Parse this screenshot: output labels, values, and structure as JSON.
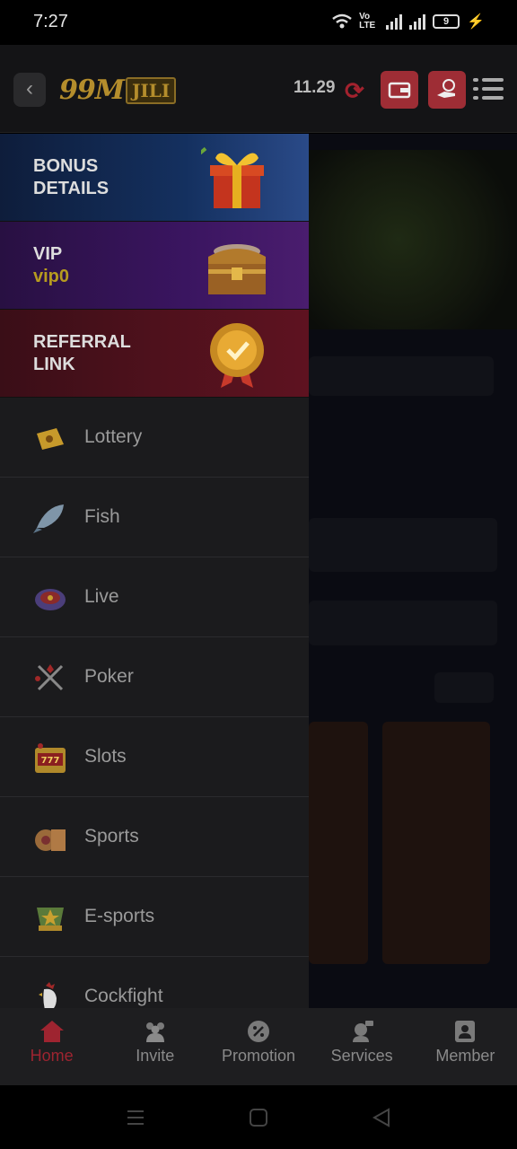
{
  "status_bar": {
    "time": "7:27",
    "network_label": "Vo LTE",
    "battery": "9"
  },
  "header": {
    "logo_main": "99M",
    "logo_badge": "JILI",
    "balance": "11.29"
  },
  "drawer": {
    "promos": [
      {
        "line1": "BONUS",
        "line2": "DETAILS"
      },
      {
        "line1": "VIP",
        "line2": "vip0"
      },
      {
        "line1": "REFERRAL",
        "line2": "LINK"
      }
    ],
    "menu": [
      {
        "label": "Lottery",
        "icon": "lottery-ticket-icon"
      },
      {
        "label": "Fish",
        "icon": "fish-icon"
      },
      {
        "label": "Live",
        "icon": "roulette-icon"
      },
      {
        "label": "Poker",
        "icon": "poker-icon"
      },
      {
        "label": "Slots",
        "icon": "slot-machine-icon"
      },
      {
        "label": "Sports",
        "icon": "sports-icon"
      },
      {
        "label": "E-sports",
        "icon": "esports-icon"
      },
      {
        "label": "Cockfight",
        "icon": "rooster-icon"
      }
    ]
  },
  "bottom_nav": {
    "items": [
      {
        "label": "Home",
        "icon": "home-icon",
        "active": true
      },
      {
        "label": "Invite",
        "icon": "invite-icon"
      },
      {
        "label": "Promotion",
        "icon": "promotion-icon"
      },
      {
        "label": "Services",
        "icon": "services-icon"
      },
      {
        "label": "Member",
        "icon": "member-icon"
      }
    ]
  },
  "colors": {
    "accent": "#9e2430",
    "gold": "#b79b1f",
    "drawer_bg": "#1b1b1d"
  }
}
